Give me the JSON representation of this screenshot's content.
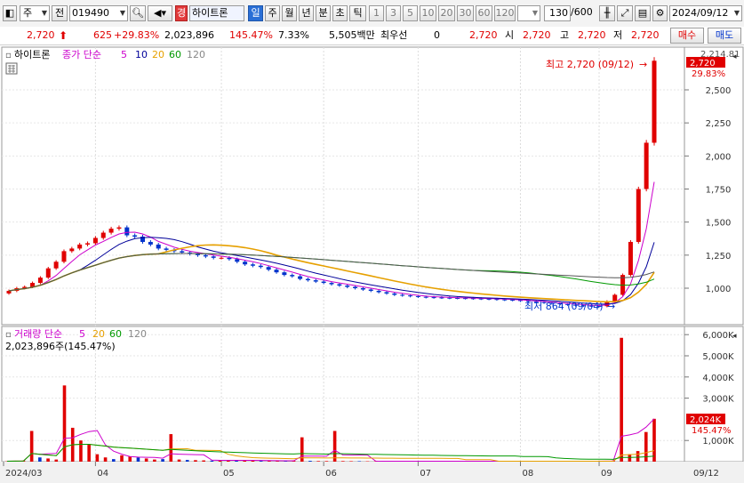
{
  "toolbar": {
    "type_label": "주",
    "scope_label": "전",
    "code": "019490",
    "badge": "경",
    "stock_name": "하이트론",
    "periods": [
      "일",
      "주",
      "월",
      "년",
      "분",
      "초",
      "틱"
    ],
    "minute_options": [
      "1",
      "3",
      "5",
      "10",
      "20",
      "30",
      "60",
      "120"
    ],
    "count_value": "130",
    "count_total": "/600",
    "date": "2024/09/12"
  },
  "quote": {
    "price": "2,720",
    "change": "625",
    "change_pct": "+29.83%",
    "volume": "2,023,896",
    "volume_ratio": "145.47%",
    "turnover_rate": "7.33%",
    "trade_value": "5,505백만",
    "preferred_label": "최우선",
    "preferred_value": "0",
    "ask_price": "2,720",
    "open_label": "시",
    "open": "2,720",
    "high_label": "고",
    "high": "2,720",
    "low_label": "저",
    "low": "2,720",
    "buy_label": "매수",
    "sell_label": "매도"
  },
  "price_panel": {
    "name_label": "하이트론",
    "ma_label": "종가 단순",
    "ma_periods": [
      "5",
      "10",
      "20",
      "60",
      "120"
    ],
    "high_note": "최고 2,720 (09/12)",
    "low_note": "최저 864 (09/04)",
    "top_label": "2,214.81",
    "current_price_tag": "2,720",
    "current_pct_tag": "29.83%",
    "axis_ticks": [
      "2,500",
      "2,250",
      "2,000",
      "1,750",
      "1,500",
      "1,250",
      "1,000"
    ]
  },
  "volume_panel": {
    "ma_label": "거래량 단순",
    "ma_periods": [
      "5",
      "20",
      "60",
      "120"
    ],
    "info": "2,023,896주(145.47%)",
    "current_tag": "2,024K",
    "pct_tag": "145.47%",
    "axis_ticks": [
      "6,000K",
      "5,000K",
      "4,000K",
      "3,000K",
      "1,000K"
    ]
  },
  "date_axis": {
    "labels": [
      "2024/03",
      "04",
      "05",
      "06",
      "07",
      "08",
      "09"
    ],
    "current": "09/12"
  },
  "colors": {
    "up": "#e00000",
    "down": "#0033cc",
    "ma5": "#cc00cc",
    "ma10": "#000099",
    "ma20": "#e6a000",
    "ma60": "#009900",
    "ma120": "#555555"
  },
  "chart_data": {
    "type": "line",
    "title": "하이트론",
    "ylim": [
      800,
      2800
    ],
    "closes": [
      980,
      1000,
      1010,
      1040,
      1080,
      1150,
      1200,
      1280,
      1300,
      1330,
      1340,
      1380,
      1420,
      1450,
      1460,
      1400,
      1390,
      1350,
      1330,
      1300,
      1290,
      1280,
      1270,
      1260,
      1250,
      1240,
      1230,
      1230,
      1220,
      1200,
      1180,
      1170,
      1160,
      1140,
      1120,
      1100,
      1090,
      1070,
      1060,
      1050,
      1040,
      1030,
      1020,
      1010,
      1000,
      990,
      980,
      970,
      960,
      950,
      945,
      940,
      935,
      932,
      930,
      928,
      926,
      925,
      924,
      922,
      920,
      918,
      915,
      912,
      910,
      905,
      900,
      895,
      890,
      885,
      880,
      875,
      870,
      868,
      866,
      864,
      900,
      950,
      1100,
      1350,
      1750,
      2100,
      2720
    ],
    "volumes_k": [
      20,
      30,
      50,
      1450,
      200,
      150,
      100,
      3600,
      1600,
      1000,
      800,
      350,
      200,
      120,
      300,
      250,
      200,
      150,
      100,
      120,
      1300,
      100,
      80,
      70,
      60,
      50,
      60,
      80,
      70,
      60,
      50,
      40,
      40,
      40,
      50,
      40,
      1150,
      40,
      30,
      30,
      1450,
      30,
      25,
      25,
      20,
      20,
      20,
      20,
      20,
      20,
      25,
      20,
      20,
      20,
      20,
      20,
      20,
      20,
      20,
      20,
      20,
      20,
      20,
      20,
      20,
      20,
      20,
      20,
      20,
      20,
      20,
      20,
      30,
      40,
      50,
      5850,
      350,
      500,
      1400,
      2024
    ]
  }
}
